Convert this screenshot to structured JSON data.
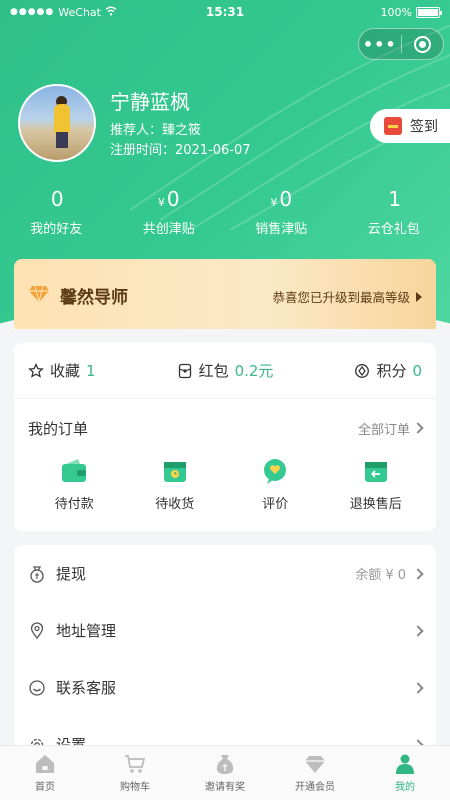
{
  "statusbar": {
    "carrier": "WeChat",
    "time": "15:31",
    "battery": "100%"
  },
  "profile": {
    "name": "宁静蓝枫",
    "referrer": "推荐人：臻之筱",
    "register_time": "注册时间：2021-06-07"
  },
  "signin": {
    "label": "签到"
  },
  "stats": [
    {
      "prefix": "",
      "value": "0",
      "label": "我的好友"
    },
    {
      "prefix": "¥",
      "value": "0",
      "label": "共创津贴"
    },
    {
      "prefix": "¥",
      "value": "0",
      "label": "销售津贴"
    },
    {
      "prefix": "",
      "value": "1",
      "label": "云仓礼包"
    }
  ],
  "vip": {
    "title": "馨然导师",
    "message": "恭喜您已升级到最高等级"
  },
  "points": {
    "favorites_label": "收藏",
    "favorites_value": "1",
    "redpack_label": "红包",
    "redpack_value": "0.2元",
    "score_label": "积分",
    "score_value": "0"
  },
  "orders": {
    "title": "我的订单",
    "all_label": "全部订单",
    "items": [
      {
        "label": "待付款",
        "icon": "wallet-icon"
      },
      {
        "label": "待收货",
        "icon": "package-icon"
      },
      {
        "label": "评价",
        "icon": "comment-heart-icon"
      },
      {
        "label": "退换售后",
        "icon": "return-icon"
      }
    ]
  },
  "menu": [
    {
      "label": "提现",
      "right": "余额 ¥ 0",
      "icon": "money-bag-icon"
    },
    {
      "label": "地址管理",
      "right": "",
      "icon": "location-icon"
    },
    {
      "label": "联系客服",
      "right": "",
      "icon": "service-icon"
    },
    {
      "label": "设置",
      "right": "",
      "icon": "gear-icon"
    }
  ],
  "tabbar": [
    {
      "label": "首页",
      "icon": "home-icon"
    },
    {
      "label": "购物车",
      "icon": "cart-icon"
    },
    {
      "label": "邀请有奖",
      "icon": "reward-bag-icon"
    },
    {
      "label": "开通会员",
      "icon": "diamond-icon"
    },
    {
      "label": "我的",
      "icon": "user-icon"
    }
  ],
  "colors": {
    "primary": "#2fc08a",
    "accent_value": "#3bb98a",
    "vip_text": "#5b3a14"
  }
}
